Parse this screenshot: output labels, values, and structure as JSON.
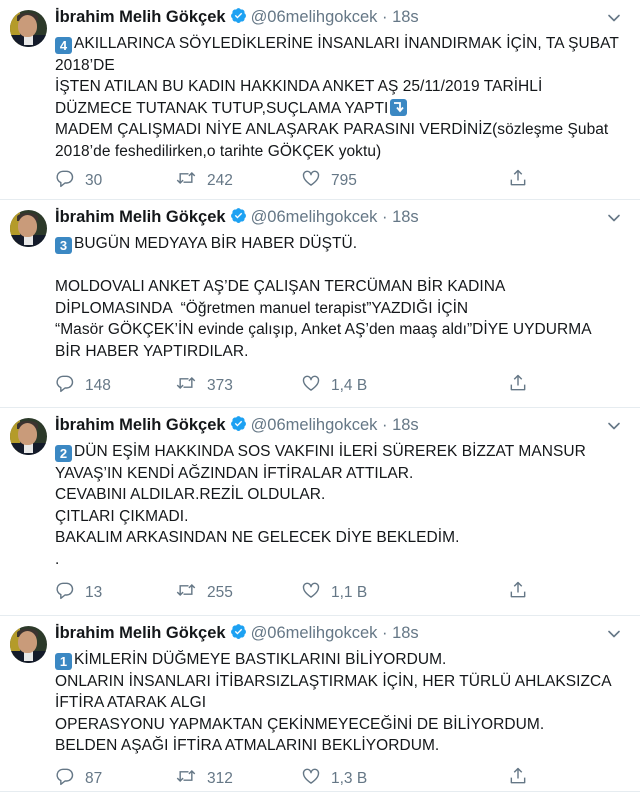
{
  "tweets": [
    {
      "name": "İbrahim Melih Gökçek",
      "handle": "@06melihgokcek",
      "dot": "·",
      "time": "18s",
      "badge": "4",
      "lines": [
        "AKILLARINCA SÖYLEDİKLERİNE İNSANLARI İNANDIRMAK İÇİN, TA ŞUBAT 2018’DE",
        "İŞTEN ATILAN BU KADIN HAKKINDA ANKET AŞ 25/11/2019 TARİHLİ",
        "DÜZMECE TUTANAK TUTUP,SUÇLAMA YAPTI",
        "MADEM ÇALIŞMADI NİYE ANLAŞARAK PARASINI VERDİNİZ(sözleşme Şubat",
        "2018’de feshedilirken,o tarihte GÖKÇEK yoktu)"
      ],
      "replies": "30",
      "retweets": "242",
      "likes": "795"
    },
    {
      "name": "İbrahim Melih Gökçek",
      "handle": "@06melihgokcek",
      "dot": "·",
      "time": "18s",
      "badge": "3",
      "lines": [
        "BUGÜN MEDYAYA BİR HABER DÜŞTÜ.",
        "",
        "MOLDOVALI ANKET AŞ’DE ÇALIŞAN TERCÜMAN BİR KADINA",
        "DİPLOMASINDA  “Öğretmen manuel terapist”YAZDIĞI İÇİN",
        "“Masör GÖKÇEK’İN evinde çalışıp, Anket AŞ’den maaş aldı”DİYE UYDURMA",
        "BİR HABER YAPTIRDILAR."
      ],
      "replies": "148",
      "retweets": "373",
      "likes": "1,4 B"
    },
    {
      "name": "İbrahim Melih Gökçek",
      "handle": "@06melihgokcek",
      "dot": "·",
      "time": "18s",
      "badge": "2",
      "lines": [
        "DÜN EŞİM HAKKINDA SOS VAKFINI İLERİ SÜREREK BİZZAT MANSUR",
        "YAVAŞ’IN KENDİ AĞZINDAN İFTİRALAR ATTILAR.",
        "CEVABINI ALDILAR.REZİL OLDULAR.",
        "ÇITLARI ÇIKMADI.",
        "BAKALIM ARKASINDAN NE GELECEK DİYE BEKLEDİM.",
        "."
      ],
      "replies": "13",
      "retweets": "255",
      "likes": "1,1 B"
    },
    {
      "name": "İbrahim Melih Gökçek",
      "handle": "@06melihgokcek",
      "dot": "·",
      "time": "18s",
      "badge": "1",
      "lines": [
        "KİMLERİN DÜĞMEYE BASTIKLARINI BİLİYORDUM.",
        "ONLARIN İNSANLARI İTİBARSIZLAŞTIRMAK İÇİN, HER TÜRLÜ AHLAKSIZCA",
        "İFTİRA ATARAK ALGI",
        "OPERASYONU YAPMAKTAN ÇEKİNMEYECEĞİNİ DE BİLİYORDUM.",
        "BELDEN AŞAĞI İFTİRA ATMALARINI BEKLİYORDUM."
      ],
      "replies": "87",
      "retweets": "312",
      "likes": "1,3 B"
    }
  ],
  "icons": {
    "verified": "verified-badge-icon",
    "caret": "chevron-down-icon",
    "reply": "reply-icon",
    "retweet": "retweet-icon",
    "like": "heart-icon",
    "share": "share-icon"
  },
  "colors": {
    "accent": "#1da1f2",
    "muted": "#657786",
    "keycap": "#3b88c3"
  }
}
